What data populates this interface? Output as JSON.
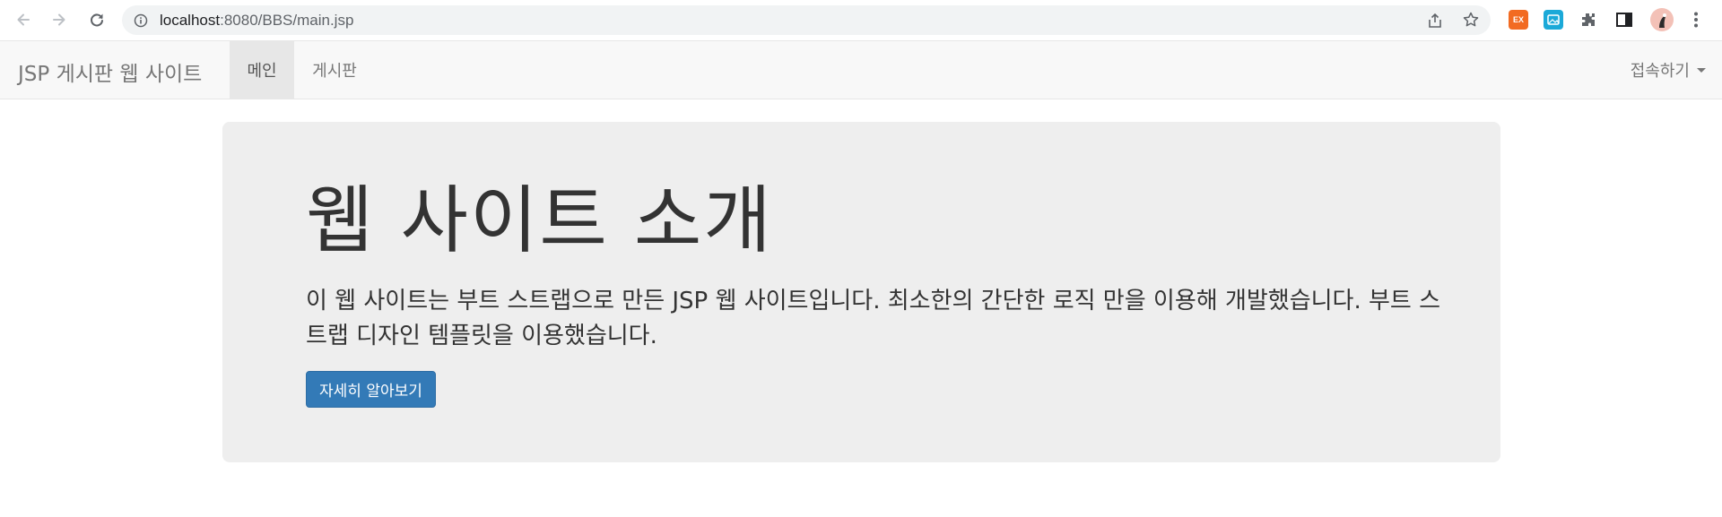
{
  "browser": {
    "url_host": "localhost",
    "url_path": ":8080/BBS/main.jsp",
    "extension_ex_label": "EX",
    "icons": [
      "back-arrow-icon",
      "forward-arrow-icon",
      "reload-icon",
      "info-icon",
      "share-icon",
      "star-icon",
      "puzzle-icon",
      "side-panel-icon",
      "more-vert-icon"
    ]
  },
  "navbar": {
    "brand": "JSP 게시판 웹 사이트",
    "items": [
      {
        "label": "메인",
        "active": true
      },
      {
        "label": "게시판",
        "active": false
      }
    ],
    "dropdown_label": "접속하기"
  },
  "jumbotron": {
    "title": "웹 사이트 소개",
    "text": "이 웹 사이트는 부트 스트랩으로 만든 JSP 웹 사이트입니다. 최소한의 간단한 로직 만을 이용해 개발했습니다. 부트 스트랩 디자인 템플릿을 이용했습니다.",
    "button_label": "자세히 알아보기"
  },
  "colors": {
    "primary": "#337ab7",
    "navbar_bg": "#f8f8f8",
    "jumbotron_bg": "#eeeeee"
  }
}
